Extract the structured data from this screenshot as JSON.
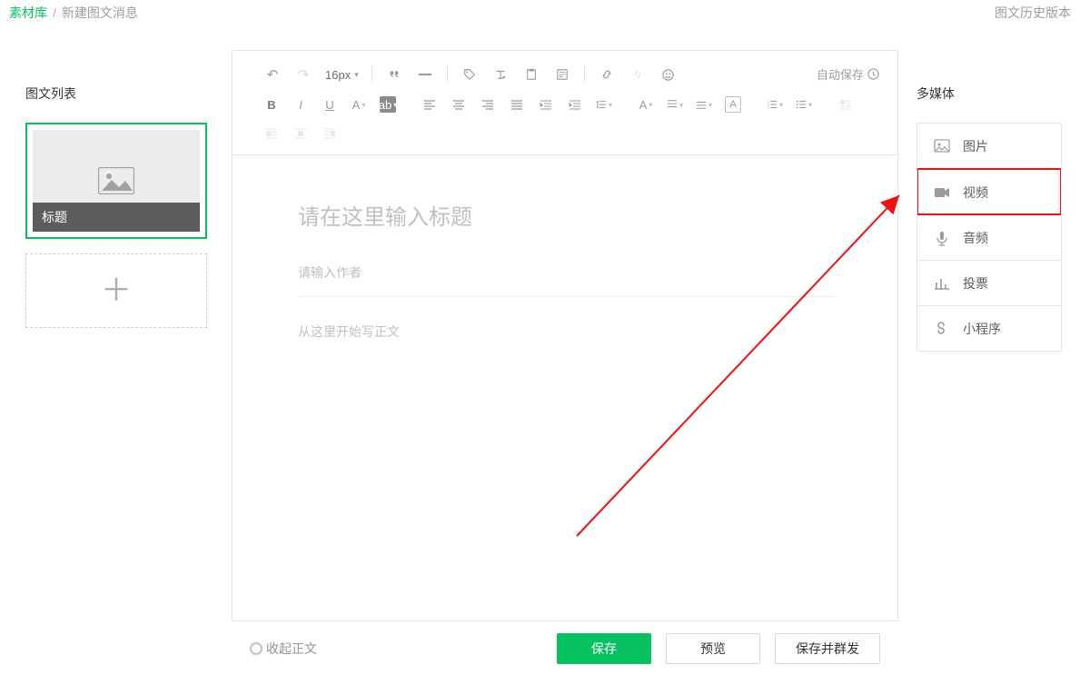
{
  "breadcrumb": {
    "root": "素材库",
    "sep": "/",
    "current": "新建图文消息"
  },
  "header": {
    "history_link": "图文历史版本"
  },
  "left": {
    "title": "图文列表",
    "article_caption": "标题"
  },
  "toolbar": {
    "font_size": "16px",
    "autosave": "自动保存"
  },
  "editor": {
    "title_placeholder": "请在这里输入标题",
    "author_placeholder": "请输入作者",
    "body_placeholder": "从这里开始写正文"
  },
  "footer": {
    "collapse": "收起正文",
    "save": "保存",
    "preview": "预览",
    "save_and_send": "保存并群发"
  },
  "right": {
    "title": "多媒体",
    "items": [
      {
        "label": "图片"
      },
      {
        "label": "视频"
      },
      {
        "label": "音频"
      },
      {
        "label": "投票"
      },
      {
        "label": "小程序"
      }
    ]
  }
}
